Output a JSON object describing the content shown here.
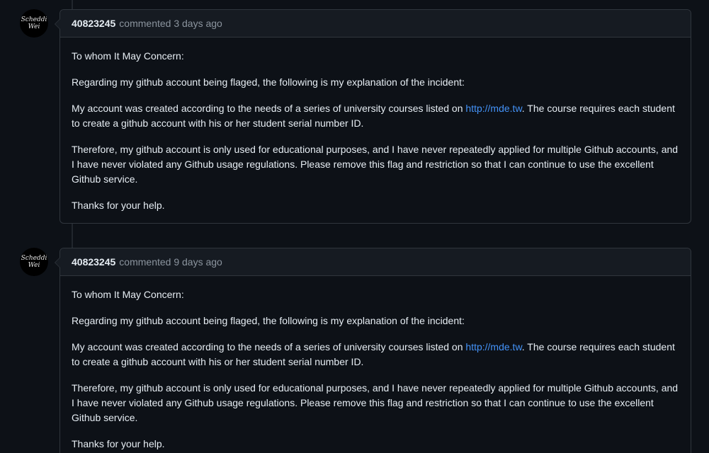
{
  "comments": [
    {
      "avatar_lines": [
        "Scheddi",
        "Wei"
      ],
      "author": "40823245",
      "action": "commented",
      "time": "3 days ago",
      "greeting": "To whom It May Concern:",
      "p1": "Regarding my github account being flaged, the following is my explanation of the incident:",
      "p2_before": "My account was created according to the needs of a series of university courses listed on ",
      "p2_link": "http://mde.tw",
      "p2_after": ". The course requires each student to create a github account with his or her student serial number ID.",
      "p3": "Therefore, my github account is only used for educational purposes, and I have never repeatedly applied for multiple Github accounts, and I have never violated any Github usage regulations. Please remove this flag and restriction so that I can continue to use the excellent Github service.",
      "closing": "Thanks for your help."
    },
    {
      "avatar_lines": [
        "Scheddi",
        "Wei"
      ],
      "author": "40823245",
      "action": "commented",
      "time": "9 days ago",
      "greeting": "To whom It May Concern:",
      "p1": "Regarding my github account being flaged, the following is my explanation of the incident:",
      "p2_before": "My account was created according to the needs of a series of university courses listed on ",
      "p2_link": "http://mde.tw",
      "p2_after": ". The course requires each student to create a github account with his or her student serial number ID.",
      "p3": "Therefore, my github account is only used for educational purposes, and I have never repeatedly applied for multiple Github accounts, and I have never violated any Github usage regulations. Please remove this flag and restriction so that I can continue to use the excellent Github service.",
      "closing": "Thanks for your help."
    }
  ],
  "colors": {
    "background": "#0d1117",
    "header_bg": "#161b22",
    "border": "#30363d",
    "link": "#4493f8",
    "muted_text": "#8b949e"
  }
}
